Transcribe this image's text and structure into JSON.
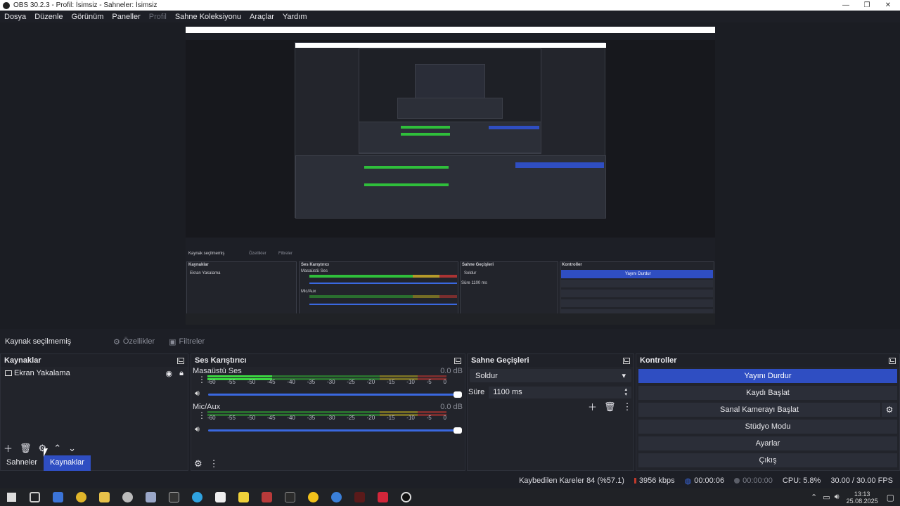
{
  "window": {
    "title": "OBS 30.2.3 - Profil: İsimsiz - Sahneler: İsimsiz"
  },
  "menu": [
    "Dosya",
    "Düzenle",
    "Görünüm",
    "Paneller",
    "Profil",
    "Sahne Koleksiyonu",
    "Araçlar",
    "Yardım"
  ],
  "context": {
    "no_selection": "Kaynak seçilmemiş",
    "properties": "Özellikler",
    "filters": "Filtreler"
  },
  "sources": {
    "title": "Kaynaklar",
    "items": [
      {
        "label": "Ekran Yakalama"
      }
    ],
    "tabs": {
      "scenes": "Sahneler",
      "sources": "Kaynaklar"
    }
  },
  "mixer": {
    "title": "Ses Karıştırıcı",
    "channels": [
      {
        "name": "Masaüstü Ses",
        "db": "0.0 dB",
        "level1": 0.27,
        "level2": 0.27
      },
      {
        "name": "Mic/Aux",
        "db": "0.0 dB",
        "level1": 0.0,
        "level2": 0.0
      }
    ],
    "scale": [
      "-60",
      "-55",
      "-50",
      "-45",
      "-40",
      "-35",
      "-30",
      "-25",
      "-20",
      "-15",
      "-10",
      "-5",
      "0"
    ]
  },
  "transitions": {
    "title": "Sahne Geçişleri",
    "selected": "Soldur",
    "duration_label": "Süre",
    "duration": "1100 ms"
  },
  "controls": {
    "title": "Kontroller",
    "stop_stream": "Yayını Durdur",
    "start_record": "Kaydı Başlat",
    "virtual_cam": "Sanal Kamerayı Başlat",
    "studio_mode": "Stüdyo Modu",
    "settings": "Ayarlar",
    "exit": "Çıkış"
  },
  "status": {
    "dropped": "Kaybedilen Kareler 84 (%57.1)",
    "bitrate": "3956 kbps",
    "stream_time": "00:00:06",
    "rec_time": "00:00:00",
    "cpu": "CPU: 5.8%",
    "fps": "30.00 / 30.00 FPS"
  },
  "tray": {
    "time": "13:13",
    "date": "25.08.2025"
  },
  "colors": {
    "accent": "#2f4ec2",
    "meter_green": "#3bd641",
    "panel": "#22242b"
  }
}
